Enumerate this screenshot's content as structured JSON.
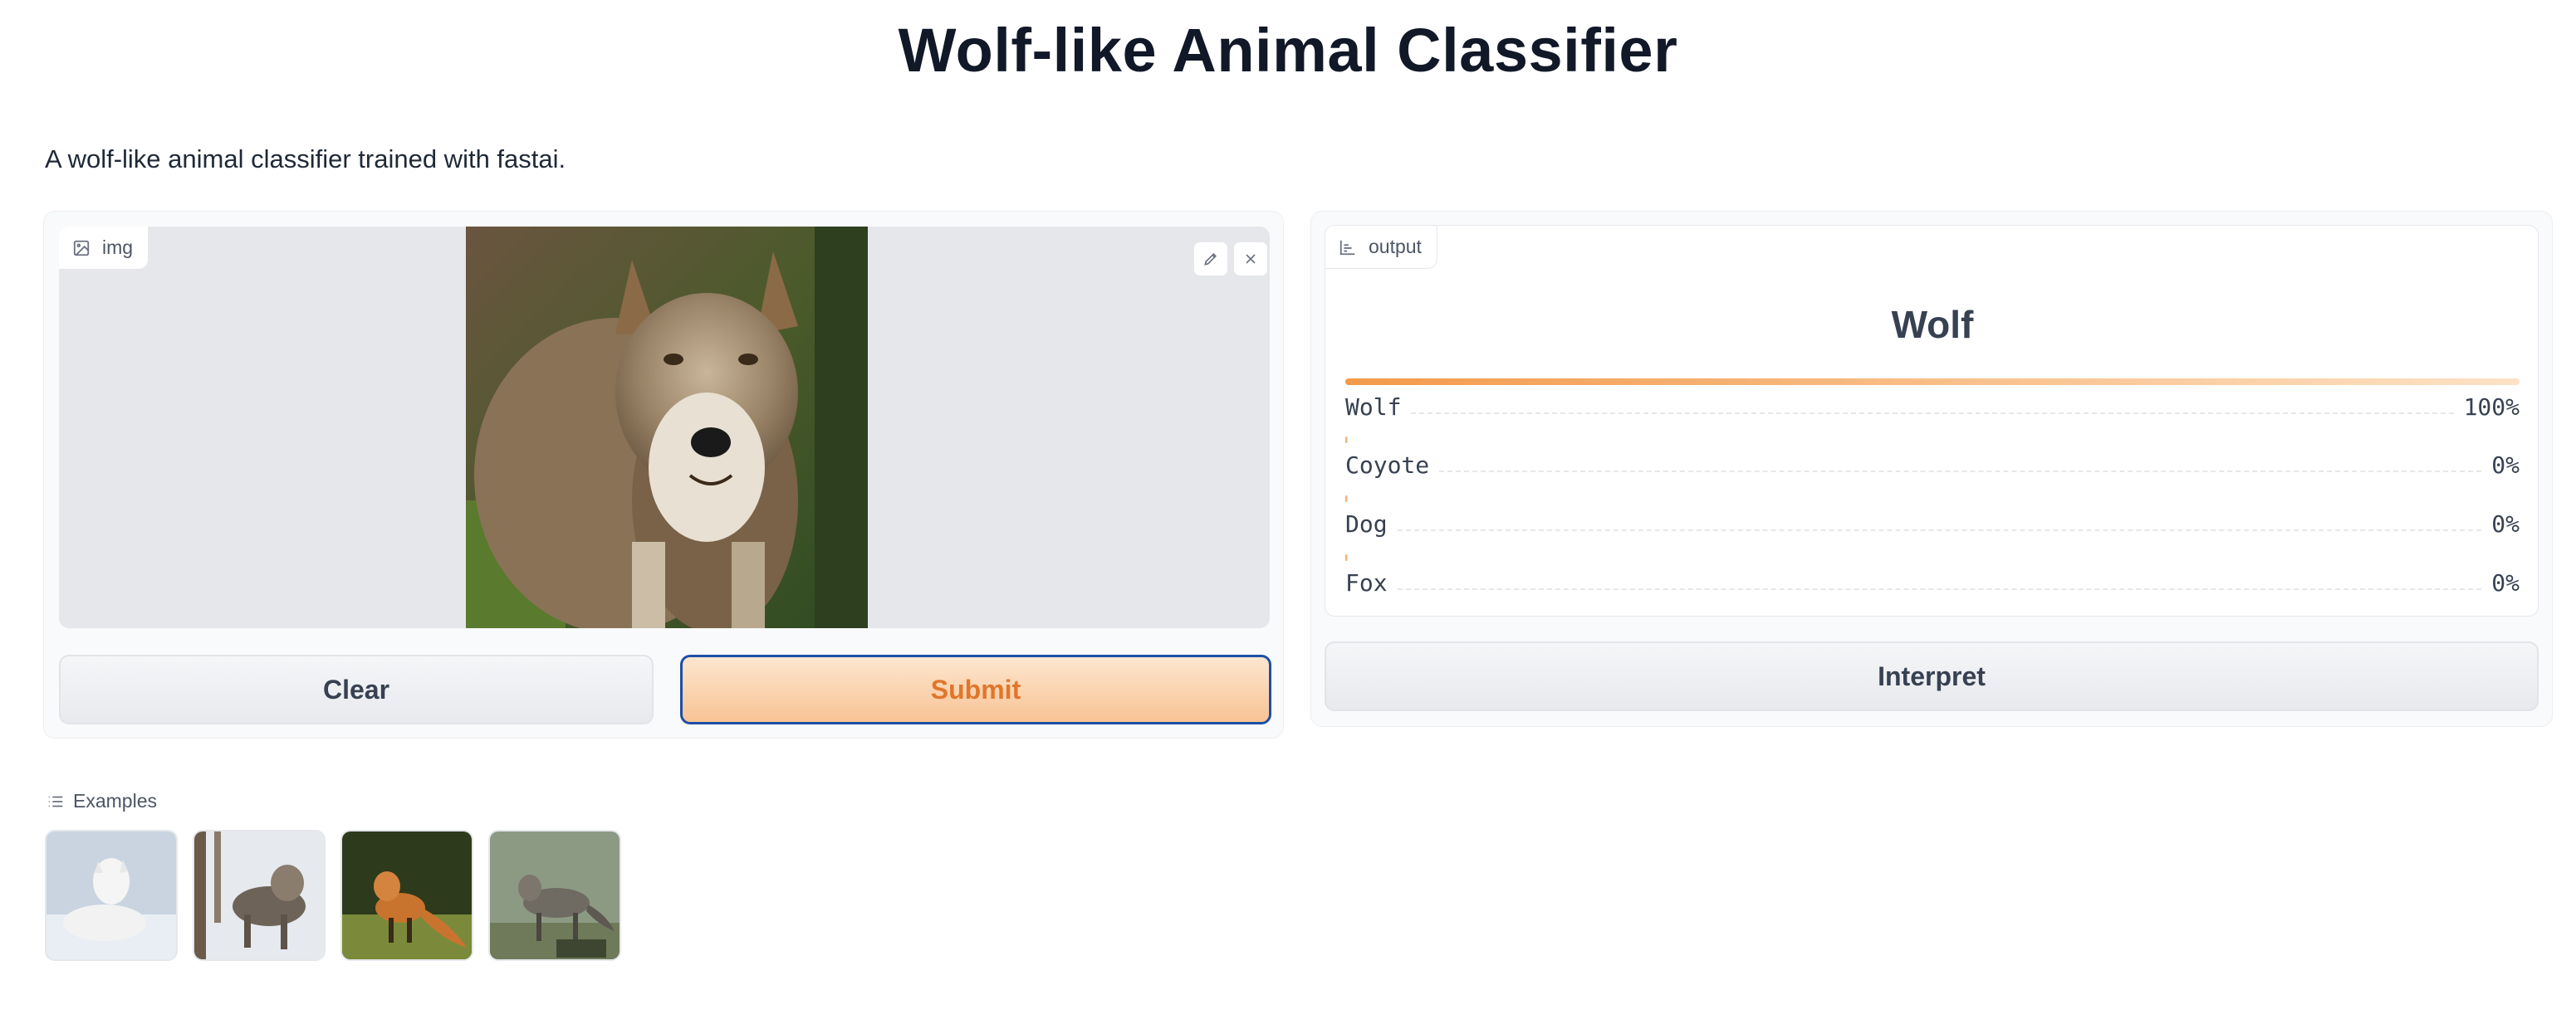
{
  "app": {
    "title": "Wolf-like Animal Classifier",
    "description": "A wolf-like animal classifier trained with fastai."
  },
  "input": {
    "label": "img",
    "icon": "image-icon",
    "tools": [
      "edit-icon",
      "close-icon"
    ]
  },
  "buttons": {
    "clear": "Clear",
    "submit": "Submit",
    "interpret": "Interpret"
  },
  "output": {
    "label": "output",
    "icon": "bar-chart-icon",
    "prediction": "Wolf",
    "confidences": [
      {
        "label": "Wolf",
        "percent": "100%",
        "value": 1.0
      },
      {
        "label": "Coyote",
        "percent": "0%",
        "value": 0.0
      },
      {
        "label": "Dog",
        "percent": "0%",
        "value": 0.0
      },
      {
        "label": "Fox",
        "percent": "0%",
        "value": 0.0
      }
    ]
  },
  "examples": {
    "label": "Examples",
    "icon": "list-icon",
    "items": [
      "white-wolf-lying-in-snow",
      "grey-wolf-in-snowy-forest",
      "red-fox-on-grass",
      "coyote-in-field"
    ]
  },
  "colors": {
    "accent": "#f39a4a",
    "submit_text": "#e0762b",
    "submit_border": "#1e4fa8"
  }
}
